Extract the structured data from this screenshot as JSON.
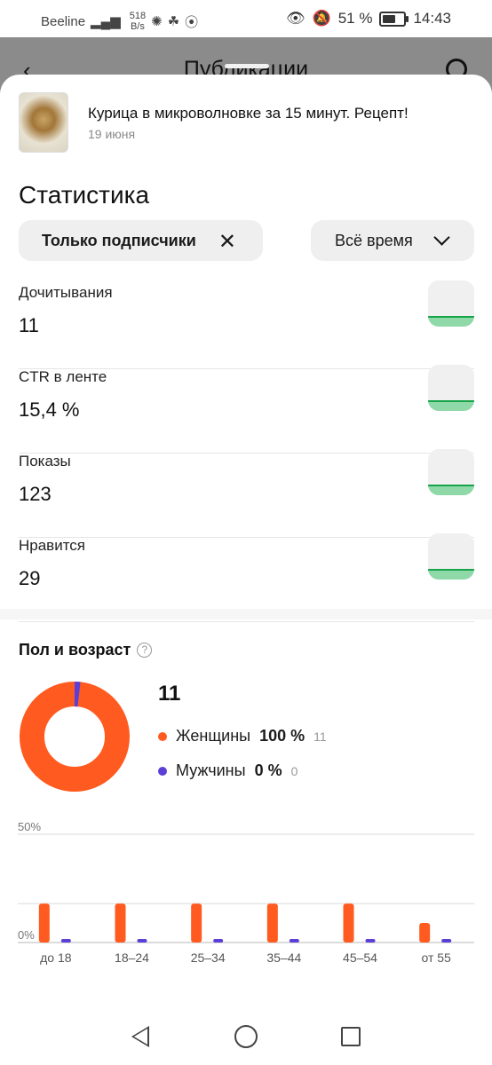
{
  "status_bar": {
    "carrier": "Beeline",
    "speed_value": "518",
    "speed_unit": "B/s",
    "battery": "51 %",
    "time": "14:43"
  },
  "header": {
    "title": "Публикации"
  },
  "post": {
    "title": "Курица в микроволновке за 15 минут. Рецепт!",
    "date": "19 июня"
  },
  "statistics": {
    "heading": "Статистика",
    "filter_label": "Только подписчики",
    "period_label": "Всё время",
    "metrics": [
      {
        "label": "Дочитывания",
        "value": "11"
      },
      {
        "label": "CTR в ленте",
        "value": "15,4 %"
      },
      {
        "label": "Показы",
        "value": "123"
      },
      {
        "label": "Нравится",
        "value": "29"
      }
    ]
  },
  "gender_age": {
    "title": "Пол и возраст",
    "help": "?",
    "total": "11",
    "legend": [
      {
        "label": "Женщины",
        "pct": "100 %",
        "count": "11",
        "color": "#ff5a1f"
      },
      {
        "label": "Мужчины",
        "pct": "0 %",
        "count": "0",
        "color": "#5b3fd6"
      }
    ]
  },
  "chart_data": [
    {
      "type": "pie",
      "labels": [
        "Женщины",
        "Мужчины"
      ],
      "values": [
        100,
        0
      ],
      "colors": [
        "#ff5a1f",
        "#5b3fd6"
      ]
    },
    {
      "type": "bar",
      "categories": [
        "до 18",
        "18–24",
        "25–34",
        "35–44",
        "45–54",
        "от 55"
      ],
      "series": [
        {
          "name": "Женщины",
          "values": [
            18,
            18,
            18,
            18,
            18,
            9
          ],
          "color": "#ff5a1f"
        },
        {
          "name": "Мужчины",
          "values": [
            0,
            0,
            0,
            0,
            0,
            0
          ],
          "color": "#5b3fd6"
        }
      ],
      "yticks": [
        "50%",
        "0%"
      ],
      "ylim": [
        0,
        50
      ],
      "grid": true
    }
  ]
}
